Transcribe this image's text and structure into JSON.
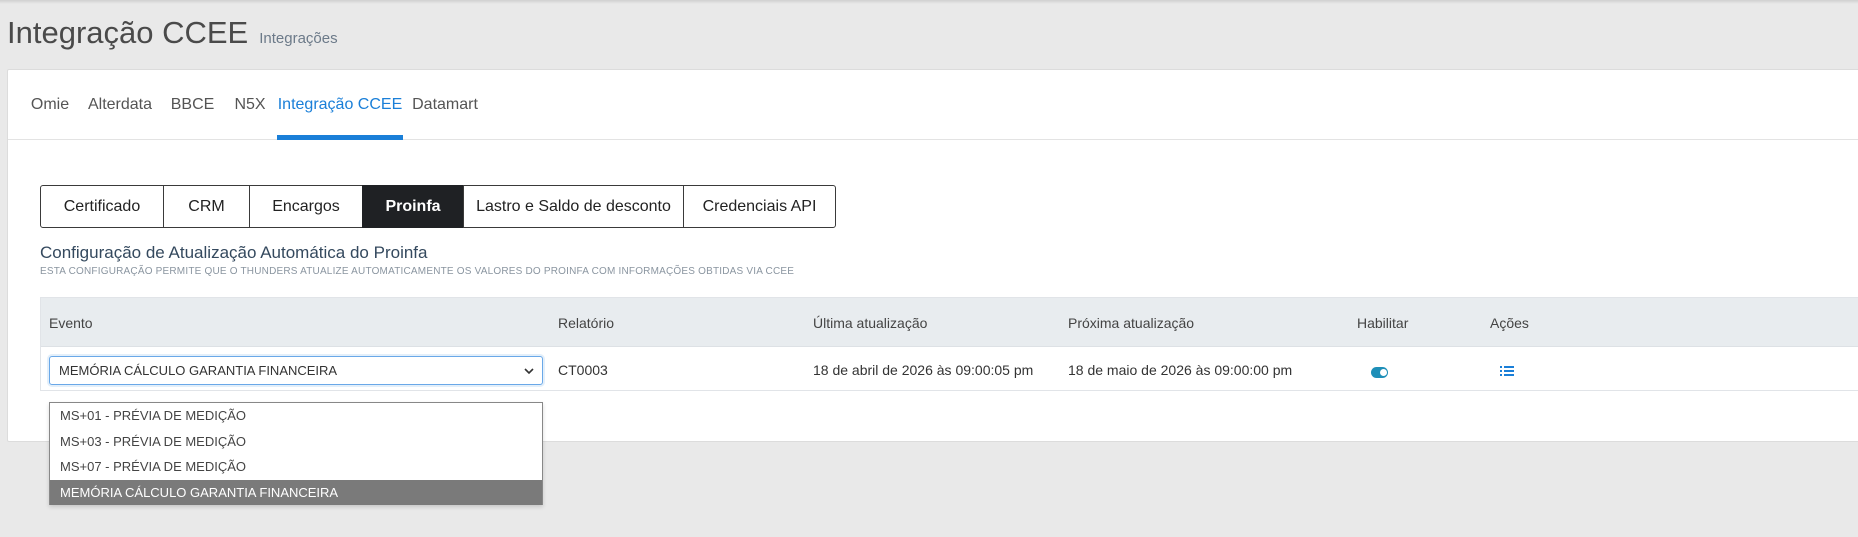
{
  "page": {
    "title": "Integração CCEE",
    "subtitle": "Integrações"
  },
  "nav_tabs": [
    {
      "label": "Omie",
      "active": false
    },
    {
      "label": "Alterdata",
      "active": false
    },
    {
      "label": "BBCE",
      "active": false
    },
    {
      "label": "N5X",
      "active": false
    },
    {
      "label": "Integração CCEE",
      "active": true
    },
    {
      "label": "Datamart",
      "active": false
    }
  ],
  "sub_tabs": [
    {
      "label": "Certificado",
      "active": false
    },
    {
      "label": "CRM",
      "active": false
    },
    {
      "label": "Encargos",
      "active": false
    },
    {
      "label": "Proinfa",
      "active": true
    },
    {
      "label": "Lastro e Saldo de desconto",
      "active": false
    },
    {
      "label": "Credenciais API",
      "active": false
    }
  ],
  "section": {
    "title": "Configuração de Atualização Automática do Proinfa",
    "description": "ESTA CONFIGURAÇÃO PERMITE QUE O THUNDERS ATUALIZE AUTOMATICAMENTE OS VALORES DO PROINFA COM INFORMAÇÕES OBTIDAS VIA CCEE"
  },
  "table": {
    "headers": {
      "evento": "Evento",
      "relatorio": "Relatório",
      "ultima": "Última atualização",
      "proxima": "Próxima atualização",
      "habilitar": "Habilitar",
      "acoes": "Ações"
    },
    "row": {
      "evento": "MEMÓRIA CÁLCULO GARANTIA FINANCEIRA",
      "relatorio": "CT0003",
      "ultima": "18 de abril de 2026 às 09:00:05 pm",
      "proxima": "18 de maio de 2026 às 09:00:00 pm",
      "habilitar": true
    }
  },
  "dropdown": {
    "options": [
      "MS+01 - PRÉVIA DE MEDIÇÃO",
      "MS+03 - PRÉVIA DE MEDIÇÃO",
      "MS+07 - PRÉVIA DE MEDIÇÃO",
      "MEMÓRIA CÁLCULO GARANTIA FINANCEIRA"
    ],
    "selected_index": 3
  },
  "colors": {
    "accent": "#1a7fd8",
    "toggle": "#1e8fb8",
    "active_subtab": "#1f2124",
    "selected_option": "#7a7a7a"
  },
  "icons": {
    "select_chevron": "chevron-down-icon",
    "actions": "list-icon"
  }
}
